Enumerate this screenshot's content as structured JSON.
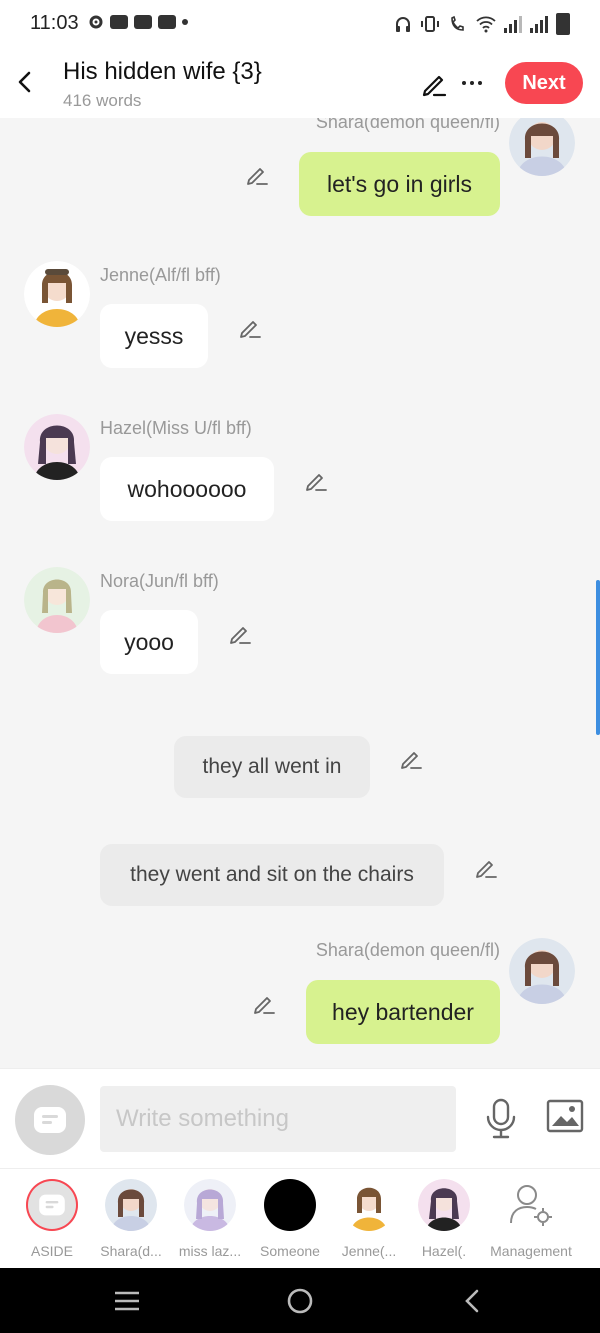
{
  "status": {
    "time": "11:03"
  },
  "header": {
    "title": "His hidden wife {3}",
    "subtitle": "416 words",
    "next_label": "Next"
  },
  "messages": [
    {
      "speaker": "Shara(demon queen/fl)",
      "text": "let's go in girls",
      "side": "right"
    },
    {
      "speaker": "Jenne(Alf/fl bff)",
      "text": "yesss",
      "side": "left"
    },
    {
      "speaker": "Hazel(Miss U/fl bff)",
      "text": "wohoooooo",
      "side": "left"
    },
    {
      "speaker": "Nora(Jun/fl bff)",
      "text": "yooo",
      "side": "left"
    },
    {
      "speaker": "",
      "text": "they all went in",
      "side": "center"
    },
    {
      "speaker": "",
      "text": "they went and sit on the chairs",
      "side": "center"
    },
    {
      "speaker": "Shara(demon queen/fl)",
      "text": "hey bartender",
      "side": "right"
    }
  ],
  "composer": {
    "placeholder": "Write something"
  },
  "roles": [
    {
      "label": "ASIDE"
    },
    {
      "label": "Shara(d..."
    },
    {
      "label": "miss laz..."
    },
    {
      "label": "Someone"
    },
    {
      "label": "Jenne(..."
    },
    {
      "label": "Hazel(."
    },
    {
      "label": "Management"
    }
  ],
  "colors": {
    "accent": "#f84752",
    "my_bubble": "#d7f28f",
    "other_bubble": "#ffffff",
    "narration_bubble": "#ebebeb",
    "scroll_indicator": "#3d8ee0"
  }
}
